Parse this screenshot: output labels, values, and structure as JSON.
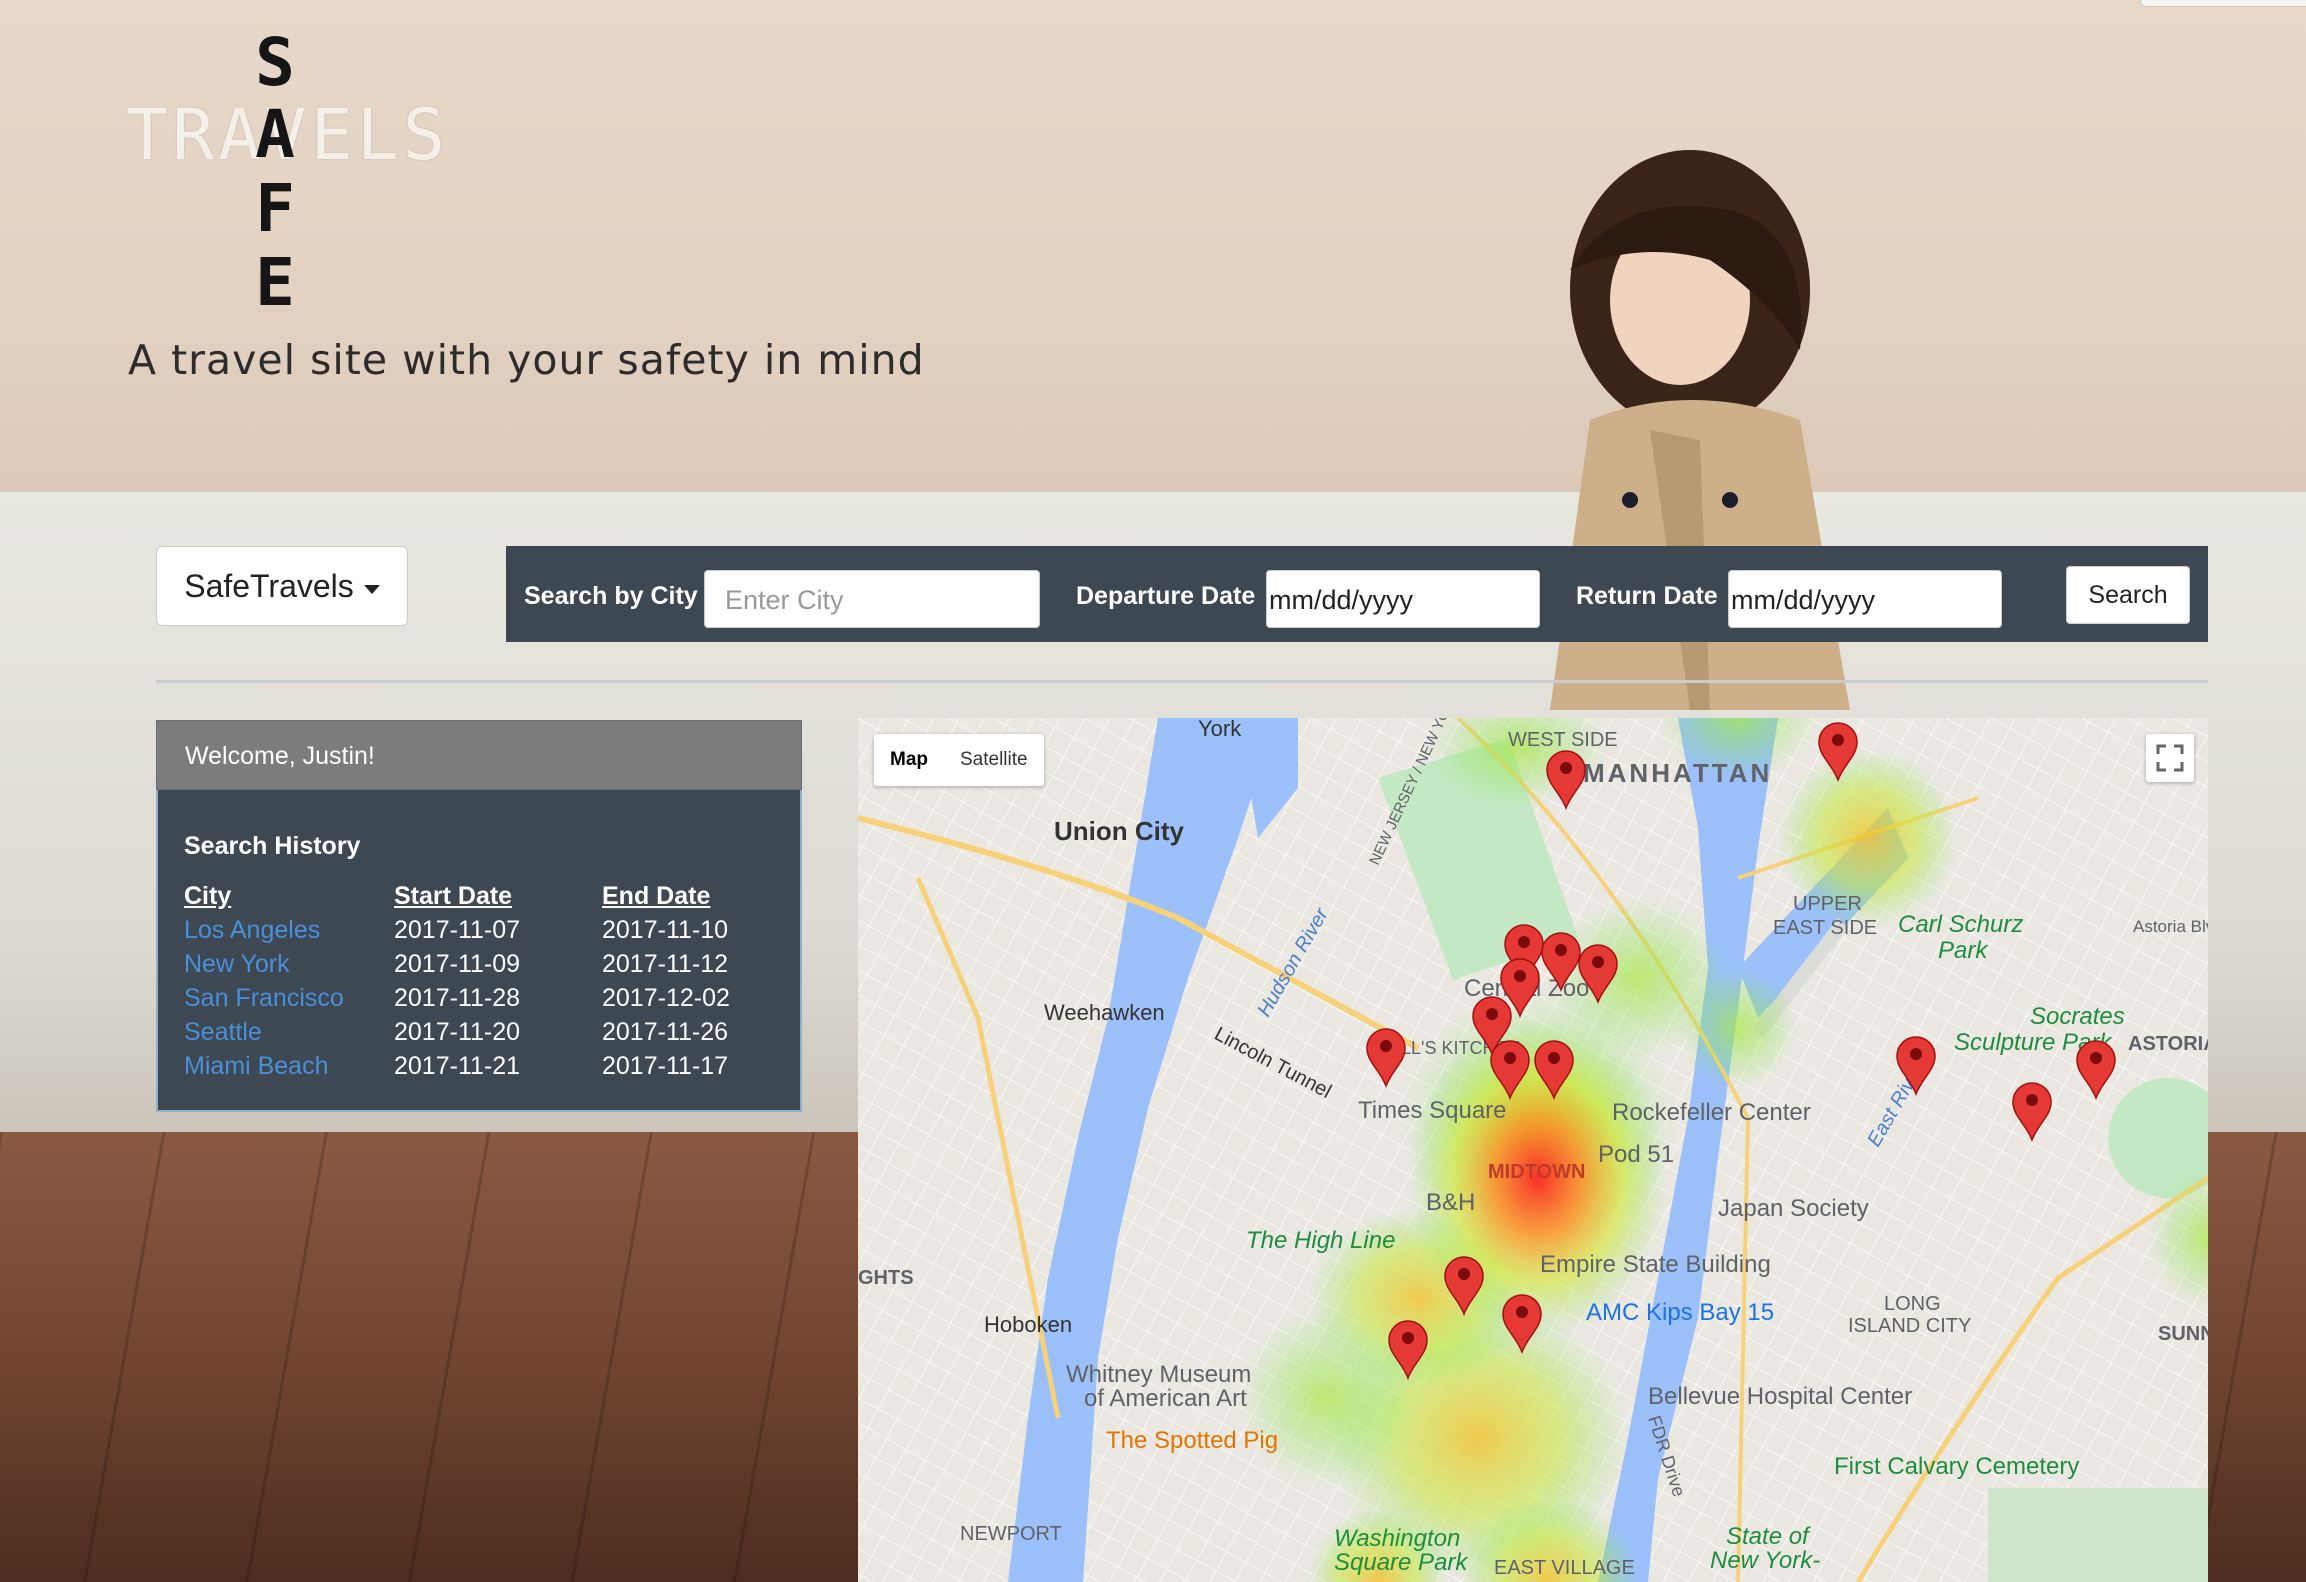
{
  "logo": {
    "word": "TRAVELS",
    "vertical_letters": [
      "S",
      "A",
      "F",
      "E"
    ]
  },
  "tagline": "A travel site with your safety in mind",
  "nav": {
    "brand_label": "SafeTravels"
  },
  "search": {
    "city_label": "Search by City",
    "city_placeholder": "Enter City",
    "departure_label": "Departure Date",
    "departure_value": "mm/dd/yyyy",
    "return_label": "Return Date",
    "return_value": "mm/dd/yyyy",
    "button_label": "Search"
  },
  "welcome": "Welcome, Justin!",
  "history": {
    "title": "Search History",
    "columns": [
      "City",
      "Start Date",
      "End Date"
    ],
    "rows": [
      {
        "city": "Los Angeles",
        "start": "2017-11-07",
        "end": "2017-11-10"
      },
      {
        "city": "New York",
        "start": "2017-11-09",
        "end": "2017-11-12"
      },
      {
        "city": "San Francisco",
        "start": "2017-11-28",
        "end": "2017-12-02"
      },
      {
        "city": "Seattle",
        "start": "2017-11-20",
        "end": "2017-11-26"
      },
      {
        "city": "Miami Beach",
        "start": "2017-11-21",
        "end": "2017-11-17"
      }
    ]
  },
  "map": {
    "type_buttons": [
      "Map",
      "Satellite"
    ],
    "active_type": "Map",
    "labels": {
      "york": "York",
      "west_side": "WEST SIDE",
      "manhattan": "MANHATTAN",
      "union_city": "Union City",
      "upper_east_side_1": "UPPER",
      "upper_east_side_2": "EAST SIDE",
      "carl_schurz_1": "Carl Schurz",
      "carl_schurz_2": "Park",
      "astoria_blvd": "Astoria Blvd",
      "weehawken": "Weehawken",
      "central_zoo": "Central    Zoo",
      "socrates_1": "Socrates",
      "socrates_2": "Sculpture Park",
      "astoria": "ASTORIA",
      "hells_kitchen": "HELL'S KITCHEN",
      "lincoln_tunnel": "Lincoln Tunnel",
      "times_square": "Times Square",
      "rockefeller": "Rockefeller Center",
      "midtown": "MIDTOWN",
      "pod51": "Pod 51",
      "bh": "B&H",
      "japan_society": "Japan Society",
      "high_line": "The High Line",
      "esb": "Empire State Building",
      "amc": "AMC Kips Bay 15",
      "hoboken": "Hoboken",
      "long_island_1": "LONG",
      "long_island_2": "ISLAND CITY",
      "whitney_1": "Whitney Museum",
      "whitney_2": "of American Art",
      "bellevue": "Bellevue Hospital Center",
      "spotted_pig": "The Spotted Pig",
      "first_calvary": "First Calvary Cemetery",
      "newport": "NEWPORT",
      "washington_1": "Washington",
      "washington_2": "Square Park",
      "east_village": "EAST VILLAGE",
      "state_of_1": "State of",
      "state_of_2": "New York-",
      "hudson_river": "Hudson River",
      "east_river": "East River",
      "fdr": "FDR Drive",
      "nj_ny": "NEW JERSEY / NEW YORK",
      "sunn": "SUNN",
      "heights": "GHTS"
    },
    "heatmap_legend": null
  },
  "colors": {
    "search_bar": "#3d4853",
    "panel_heading": "#7a7c7e",
    "link_blue": "#4a90d9",
    "marker_red": "#e53935"
  }
}
